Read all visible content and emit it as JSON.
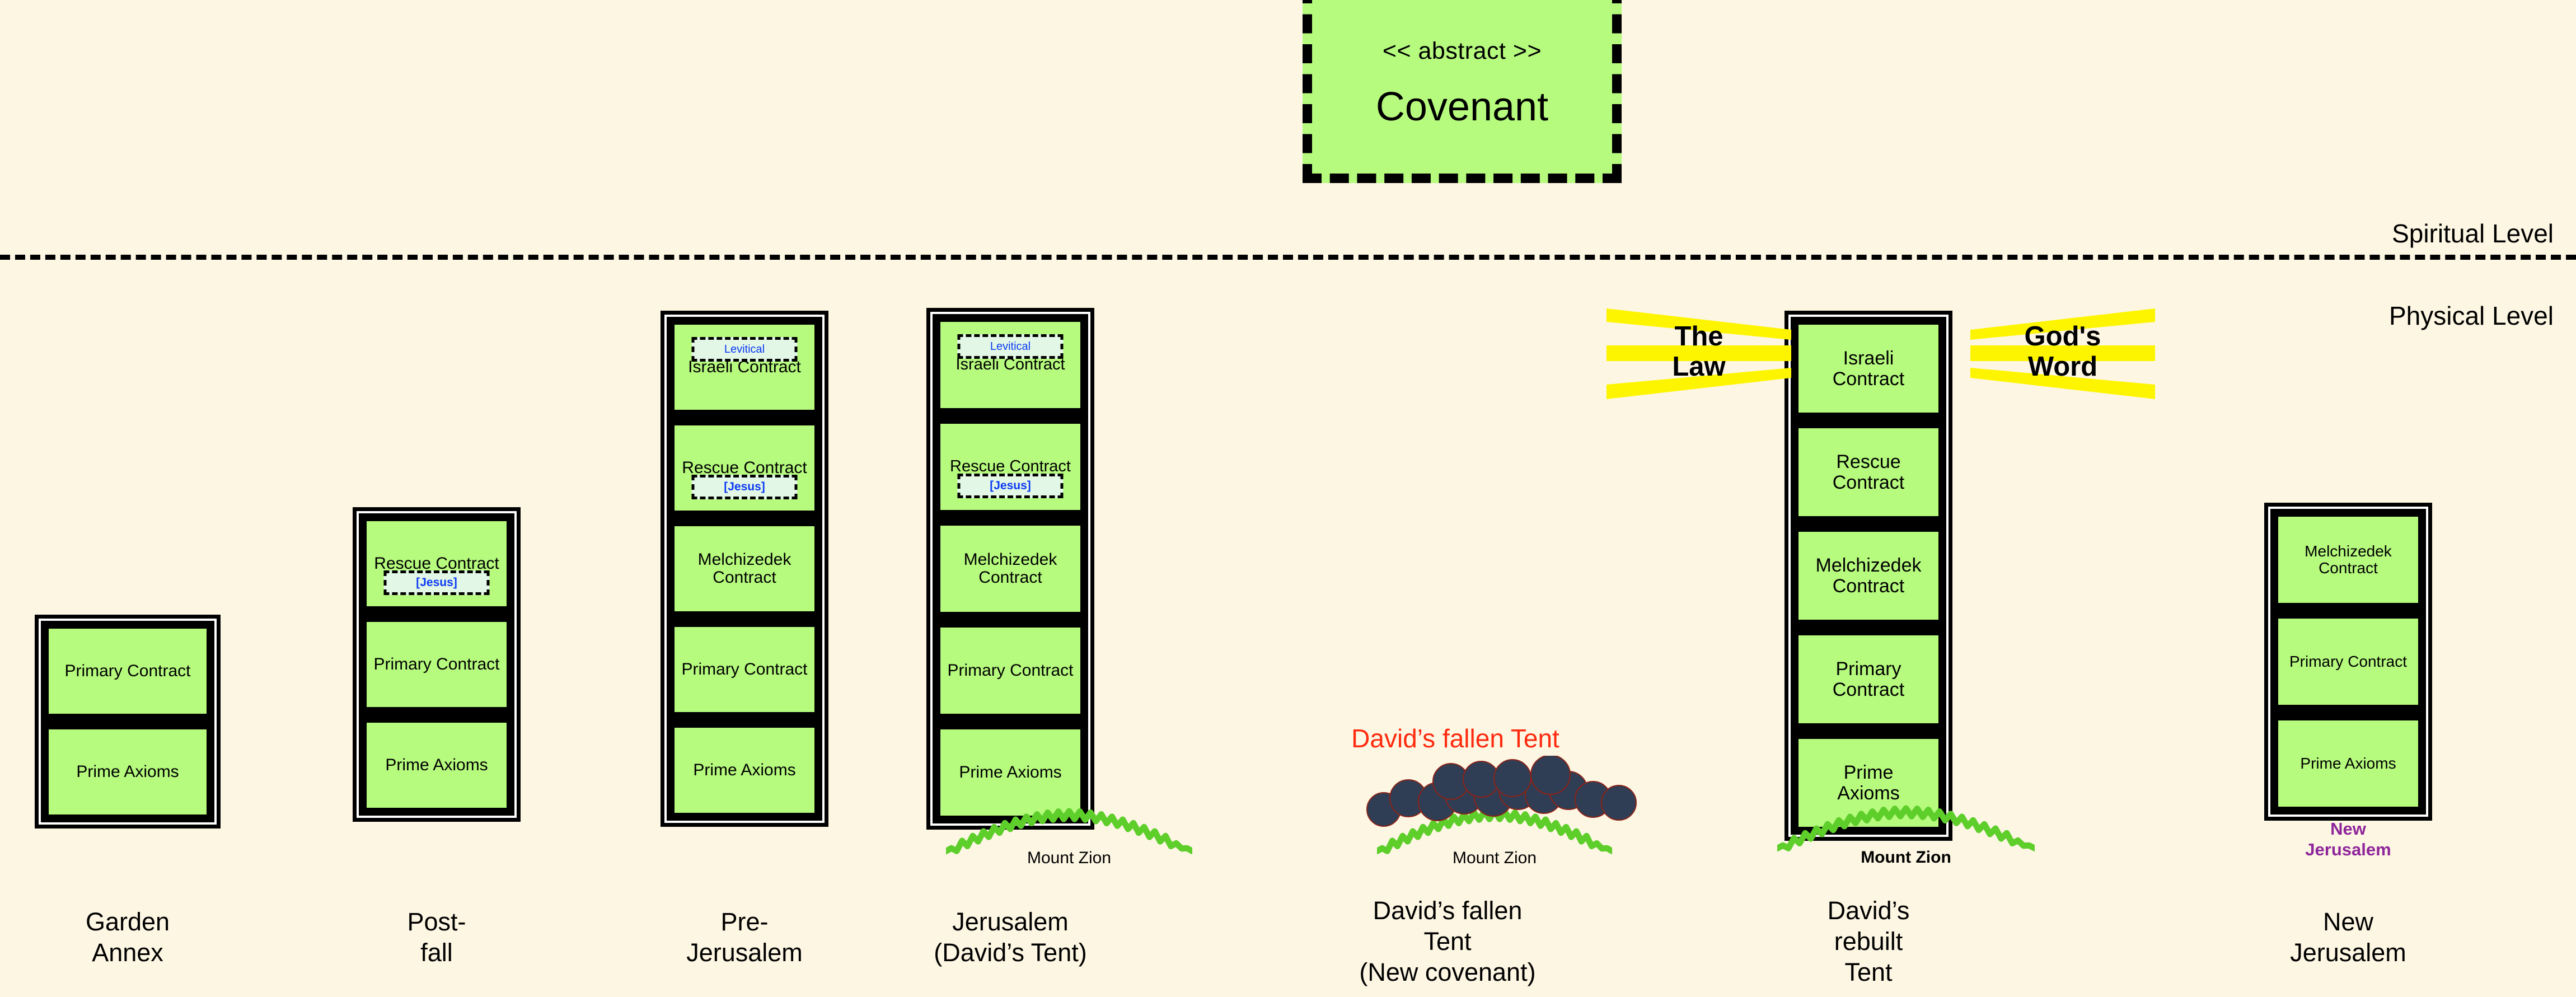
{
  "theme": {
    "background": "#fdf6e3",
    "box_fill": "#b6fa7e",
    "box_border": "#000000",
    "subtag_fill": "#e2f7e6",
    "subtag_text": "#0b39f5",
    "mount_green": "#5ece2b",
    "rubble_fill": "#2f3d55",
    "rubble_stroke": "#8c2417",
    "ray_yellow": "#fdf500",
    "accent_red": "#ff2a0f",
    "accent_purple": "#8e259b"
  },
  "abstract": {
    "stereotype": "<< abstract >>",
    "title": "Covenant"
  },
  "levels": {
    "spiritual": "Spiritual Level",
    "physical": "Physical Level"
  },
  "rays": {
    "left": {
      "label": "The\nLaw"
    },
    "right": {
      "label": "God's\nWord"
    }
  },
  "fallen_tent_title": "David’s fallen Tent",
  "columns": [
    {
      "id": "garden-annex",
      "caption": "Garden\nAnnex",
      "cells": [
        {
          "label": "Primary Contract",
          "font_size": 30,
          "subtag": null
        },
        {
          "label": "Prime Axioms",
          "font_size": 30,
          "subtag": null
        }
      ],
      "mount": null,
      "sublabel": null
    },
    {
      "id": "post-fall",
      "caption": "Post-\nfall",
      "cells": [
        {
          "label": "Rescue Contract",
          "font_size": 30,
          "subtag": {
            "text": "[Jesus]",
            "style": "jesus",
            "font_size": 21
          }
        },
        {
          "label": "Primary Contract",
          "font_size": 30,
          "subtag": null
        },
        {
          "label": "Prime Axioms",
          "font_size": 30,
          "subtag": null
        }
      ],
      "mount": null,
      "sublabel": null
    },
    {
      "id": "pre-jerusalem",
      "caption": "Pre-\nJerusalem",
      "cells": [
        {
          "label": "Israeli Contract",
          "font_size": 30,
          "subtag": {
            "text": "Levitical",
            "style": "levitical",
            "font_size": 20
          }
        },
        {
          "label": "Rescue Contract",
          "font_size": 30,
          "subtag": {
            "text": "[Jesus]",
            "style": "jesus",
            "font_size": 21
          }
        },
        {
          "label": "Melchizedek\nContract",
          "font_size": 30,
          "subtag": null
        },
        {
          "label": "Primary Contract",
          "font_size": 30,
          "subtag": null
        },
        {
          "label": "Prime Axioms",
          "font_size": 30,
          "subtag": null
        }
      ],
      "mount": null,
      "sublabel": null
    },
    {
      "id": "jerusalem-davids-tent",
      "caption": "Jerusalem\n(David’s Tent)",
      "cells": [
        {
          "label": "Israeli Contract",
          "font_size": 29,
          "subtag": {
            "text": "Levitical",
            "style": "levitical",
            "font_size": 20
          }
        },
        {
          "label": "Rescue Contract",
          "font_size": 29,
          "subtag": {
            "text": "[Jesus]",
            "style": "jesus",
            "font_size": 21
          }
        },
        {
          "label": "Melchizedek\nContract",
          "font_size": 30,
          "subtag": null
        },
        {
          "label": "Primary Contract",
          "font_size": 30,
          "subtag": null
        },
        {
          "label": "Prime Axioms",
          "font_size": 30,
          "subtag": null
        }
      ],
      "mount": {
        "label": "Mount Zion",
        "bold": false
      },
      "sublabel": null
    },
    {
      "id": "davids-fallen-tent",
      "caption": "David’s fallen\nTent\n(New covenant)",
      "cells": [],
      "mount": {
        "label": "Mount Zion",
        "bold": false
      },
      "sublabel": null
    },
    {
      "id": "davids-rebuilt-tent",
      "caption": "David’s\nrebuilt\nTent",
      "cells": [
        {
          "label": "Israeli\nContract",
          "font_size": 34,
          "subtag": null
        },
        {
          "label": "Rescue\nContract",
          "font_size": 34,
          "subtag": null
        },
        {
          "label": "Melchizedek\nContract",
          "font_size": 34,
          "subtag": null
        },
        {
          "label": "Primary\nContract",
          "font_size": 34,
          "subtag": null
        },
        {
          "label": "Prime\nAxioms",
          "font_size": 34,
          "subtag": null
        }
      ],
      "mount": {
        "label": "Mount Zion",
        "bold": true
      },
      "sublabel": null
    },
    {
      "id": "new-jerusalem",
      "caption": "New\nJerusalem",
      "cells": [
        {
          "label": "Melchizedek\nContract",
          "font_size": 28,
          "subtag": null
        },
        {
          "label": "Primary Contract",
          "font_size": 28,
          "subtag": null
        },
        {
          "label": "Prime Axioms",
          "font_size": 28,
          "subtag": null
        }
      ],
      "mount": null,
      "sublabel": "New\nJerusalem"
    }
  ]
}
